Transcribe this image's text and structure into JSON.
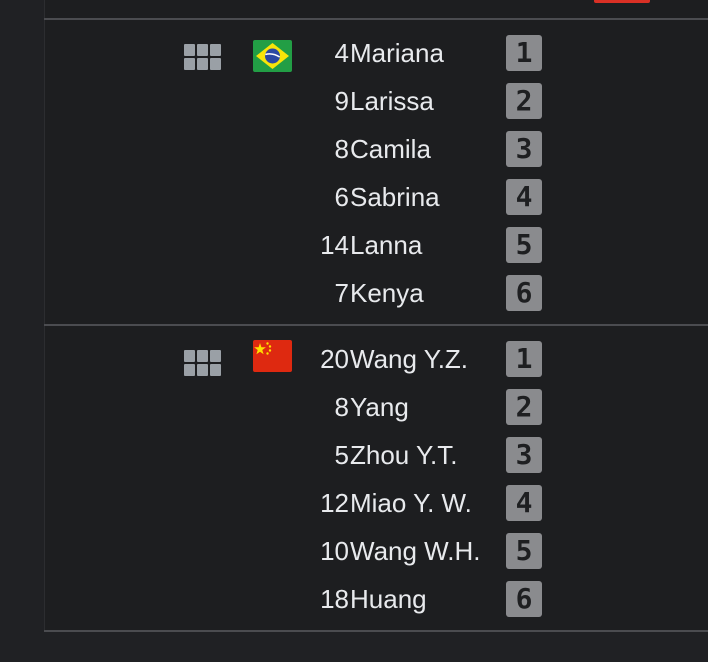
{
  "teams": [
    {
      "flag": "brazil-flag",
      "players": [
        {
          "number": "4",
          "name": "Mariana",
          "position": "1"
        },
        {
          "number": "9",
          "name": "Larissa",
          "position": "2"
        },
        {
          "number": "8",
          "name": "Camila",
          "position": "3"
        },
        {
          "number": "6",
          "name": "Sabrina",
          "position": "4"
        },
        {
          "number": "14",
          "name": "Lanna",
          "position": "5"
        },
        {
          "number": "7",
          "name": "Kenya",
          "position": "6"
        }
      ]
    },
    {
      "flag": "china-flag",
      "players": [
        {
          "number": "20",
          "name": "Wang Y.Z.",
          "position": "1"
        },
        {
          "number": "8",
          "name": "Yang",
          "position": "2"
        },
        {
          "number": "5",
          "name": "Zhou Y.T.",
          "position": "3"
        },
        {
          "number": "12",
          "name": "Miao Y. W.",
          "position": "4"
        },
        {
          "number": "10",
          "name": "Wang W.H.",
          "position": "5"
        },
        {
          "number": "18",
          "name": "Huang",
          "position": "6"
        }
      ]
    }
  ],
  "colors": {
    "background": "#202124",
    "text": "#e8eaed",
    "position_badge": "#8a8b8e",
    "divider": "#4b4c50",
    "accent": "#d93025"
  }
}
